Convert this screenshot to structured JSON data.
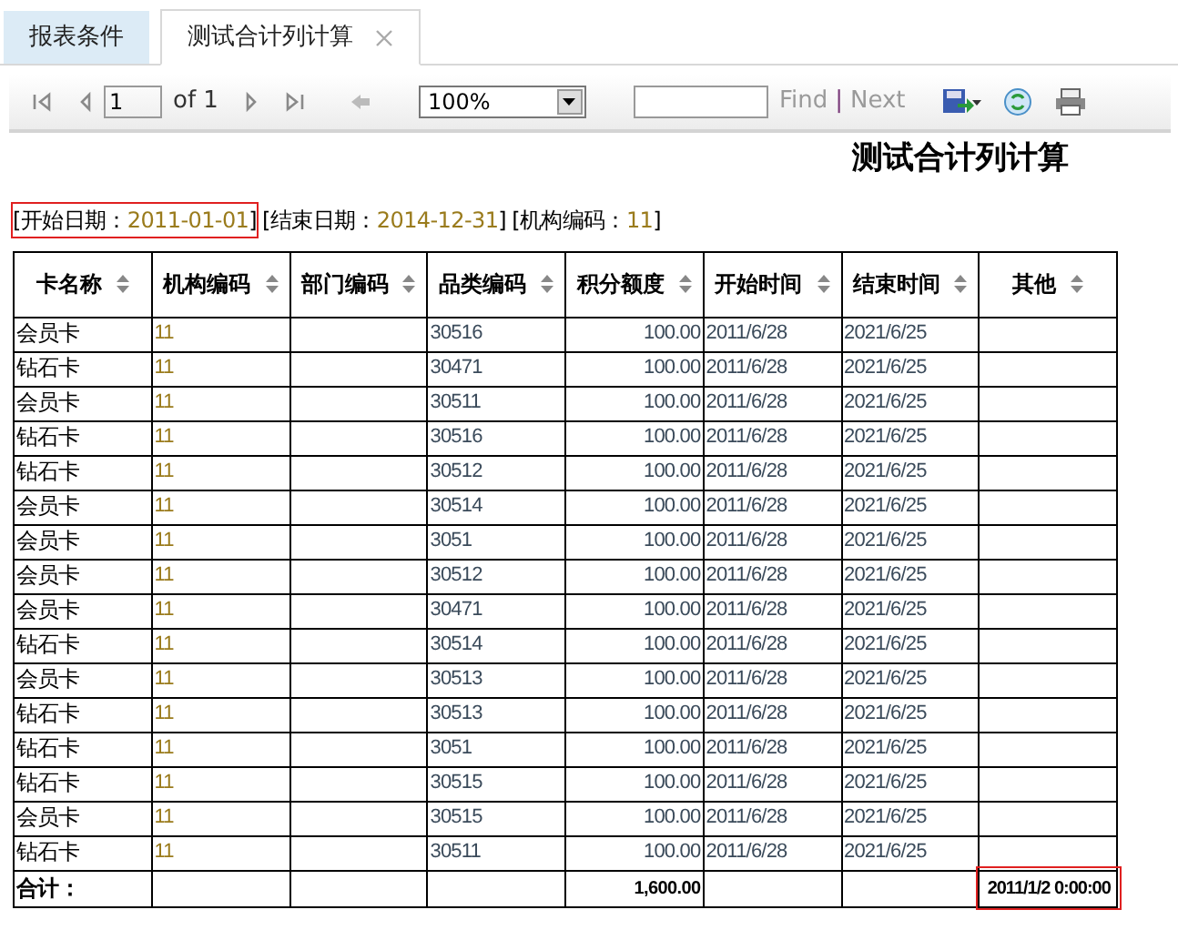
{
  "tabs": [
    {
      "label": "报表条件",
      "selected": false,
      "closable": false
    },
    {
      "label": "测试合计列计算",
      "selected": true,
      "closable": true
    }
  ],
  "toolbar": {
    "page": "1",
    "page_count": "of 1",
    "zoom": "100%",
    "find": "Find",
    "separator": "|",
    "next": "Next"
  },
  "report": {
    "title": "测试合计列计算",
    "params": [
      {
        "label": "[开始日期：",
        "value": "2011-01-01",
        "end": "]",
        "highlighted": true
      },
      {
        "label": "[结束日期：",
        "value": "2014-12-31",
        "end": "]",
        "highlighted": false
      },
      {
        "label": "[机构编码：",
        "value": "11",
        "end": "]",
        "highlighted": false
      }
    ]
  },
  "table": {
    "columns": [
      "卡名称",
      "机构编码",
      "部门编码",
      "品类编码",
      "积分额度",
      "开始时间",
      "结束时间",
      "其他"
    ],
    "rows": [
      [
        "会员卡",
        "11",
        "",
        "30516",
        "100.00",
        "2011/6/28",
        "2021/6/25",
        ""
      ],
      [
        "钻石卡",
        "11",
        "",
        "30471",
        "100.00",
        "2011/6/28",
        "2021/6/25",
        ""
      ],
      [
        "会员卡",
        "11",
        "",
        "30511",
        "100.00",
        "2011/6/28",
        "2021/6/25",
        ""
      ],
      [
        "钻石卡",
        "11",
        "",
        "30516",
        "100.00",
        "2011/6/28",
        "2021/6/25",
        ""
      ],
      [
        "钻石卡",
        "11",
        "",
        "30512",
        "100.00",
        "2011/6/28",
        "2021/6/25",
        ""
      ],
      [
        "会员卡",
        "11",
        "",
        "30514",
        "100.00",
        "2011/6/28",
        "2021/6/25",
        ""
      ],
      [
        "会员卡",
        "11",
        "",
        "3051",
        "100.00",
        "2011/6/28",
        "2021/6/25",
        ""
      ],
      [
        "会员卡",
        "11",
        "",
        "30512",
        "100.00",
        "2011/6/28",
        "2021/6/25",
        ""
      ],
      [
        "会员卡",
        "11",
        "",
        "30471",
        "100.00",
        "2011/6/28",
        "2021/6/25",
        ""
      ],
      [
        "钻石卡",
        "11",
        "",
        "30514",
        "100.00",
        "2011/6/28",
        "2021/6/25",
        ""
      ],
      [
        "会员卡",
        "11",
        "",
        "30513",
        "100.00",
        "2011/6/28",
        "2021/6/25",
        ""
      ],
      [
        "钻石卡",
        "11",
        "",
        "30513",
        "100.00",
        "2011/6/28",
        "2021/6/25",
        ""
      ],
      [
        "钻石卡",
        "11",
        "",
        "3051",
        "100.00",
        "2011/6/28",
        "2021/6/25",
        ""
      ],
      [
        "钻石卡",
        "11",
        "",
        "30515",
        "100.00",
        "2011/6/28",
        "2021/6/25",
        ""
      ],
      [
        "会员卡",
        "11",
        "",
        "30515",
        "100.00",
        "2011/6/28",
        "2021/6/25",
        ""
      ],
      [
        "钻石卡",
        "11",
        "",
        "30511",
        "100.00",
        "2011/6/28",
        "2021/6/25",
        ""
      ]
    ],
    "total": [
      {
        "text": "合计：",
        "highlighted": false
      },
      {
        "highlighted": false
      },
      {
        "highlighted": false
      },
      {
        "highlighted": false
      },
      {
        "text": "1,600.00",
        "highlighted": false
      },
      {
        "highlighted": false
      },
      {
        "highlighted": false
      },
      {
        "text": "2011/1/2 0:00:00",
        "highlighted": true
      }
    ]
  }
}
